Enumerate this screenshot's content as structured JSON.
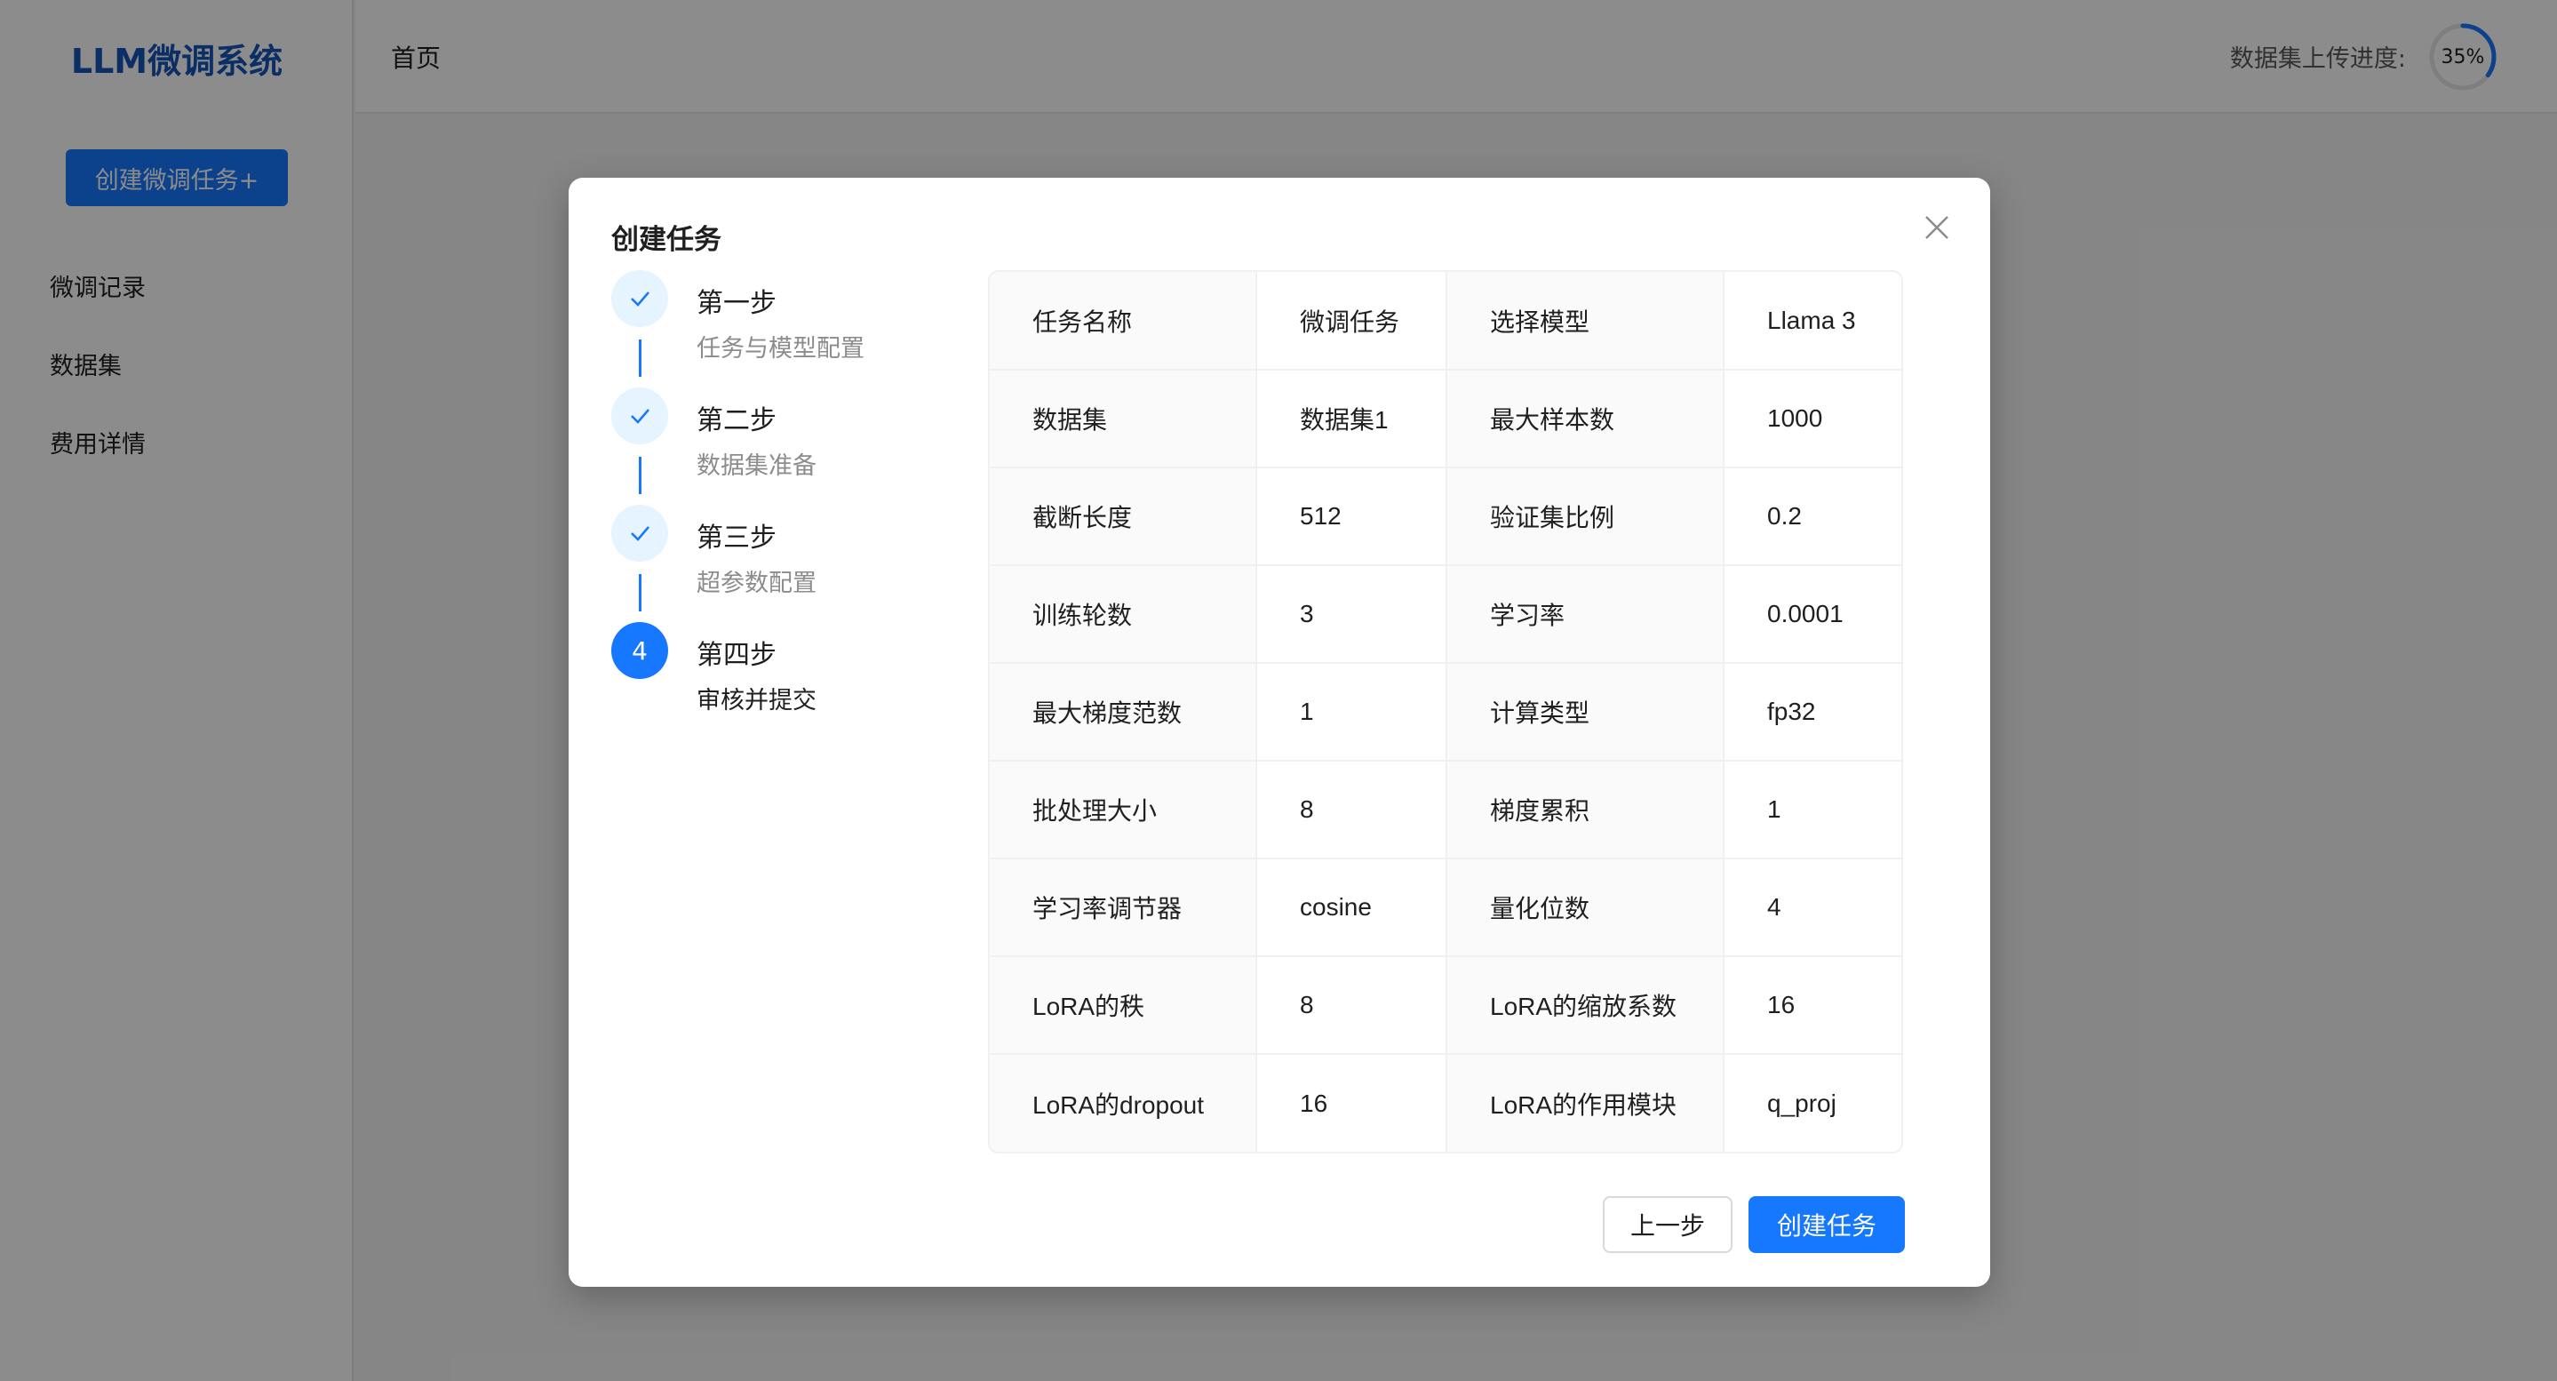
{
  "app": {
    "logo": "LLM微调系统",
    "create_button": "创建微调任务+",
    "nav": [
      "微调记录",
      "数据集",
      "费用详情"
    ],
    "header_title": "首页",
    "upload_progress_label": "数据集上传进度:",
    "upload_progress_value": 0.35,
    "upload_progress_text": "35%",
    "accent": "#1677ff"
  },
  "modal": {
    "title": "创建任务",
    "close_icon": "close-icon",
    "steps": [
      {
        "title": "第一步",
        "desc": "任务与模型配置",
        "status": "done",
        "icon": "check-icon"
      },
      {
        "title": "第二步",
        "desc": "数据集准备",
        "status": "done",
        "icon": "check-icon"
      },
      {
        "title": "第三步",
        "desc": "超参数配置",
        "status": "done",
        "icon": "check-icon"
      },
      {
        "title": "第四步",
        "desc": "审核并提交",
        "status": "active",
        "number": "4"
      }
    ],
    "table": [
      [
        "任务名称",
        "微调任务",
        "选择模型",
        "Llama 3"
      ],
      [
        "数据集",
        "数据集1",
        "最大样本数",
        "1000"
      ],
      [
        "截断长度",
        "512",
        "验证集比例",
        "0.2"
      ],
      [
        "训练轮数",
        "3",
        "学习率",
        "0.0001"
      ],
      [
        "最大梯度范数",
        "1",
        "计算类型",
        "fp32"
      ],
      [
        "批处理大小",
        "8",
        "梯度累积",
        "1"
      ],
      [
        "学习率调节器",
        "cosine",
        "量化位数",
        "4"
      ],
      [
        "LoRA的秩",
        "8",
        "LoRA的缩放系数",
        "16"
      ],
      [
        "LoRA的dropout",
        "16",
        "LoRA的作用模块",
        "q_proj"
      ]
    ],
    "prev_button": "上一步",
    "submit_button": "创建任务"
  }
}
